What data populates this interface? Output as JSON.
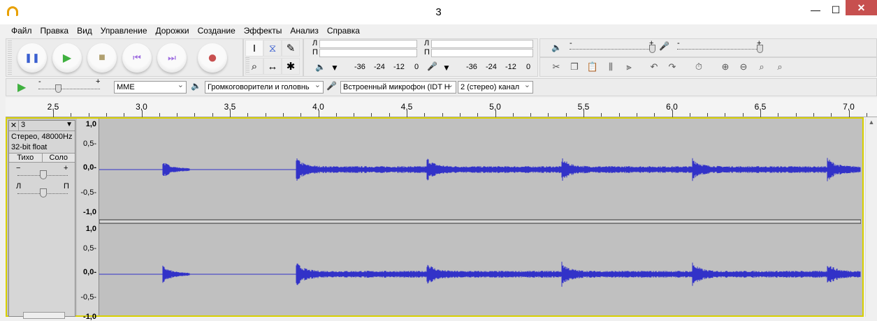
{
  "window": {
    "title": "3",
    "minimize": "—",
    "maximize": "☐",
    "close": "✕"
  },
  "menu": [
    "Файл",
    "Правка",
    "Вид",
    "Управление",
    "Дорожки",
    "Создание",
    "Эффекты",
    "Анализ",
    "Справка"
  ],
  "transport": {
    "pause": "❚❚",
    "play": "▶",
    "stop": "■",
    "skip_start": "⏮",
    "skip_end": "⏭",
    "record": "●"
  },
  "tools": {
    "select": "I",
    "envelope": "⧖",
    "draw": "✎",
    "zoom": "⌕",
    "timeshift": "↔",
    "multi": "✱"
  },
  "meters": {
    "left": "Л",
    "right": "П",
    "ticks": [
      "-36",
      "-24",
      "-12",
      "0"
    ]
  },
  "mixer": {
    "minus": "-",
    "plus": "+"
  },
  "devices": {
    "host": "MME",
    "output": "Громкоговорители и головнь",
    "input": "Встроенный микрофон (IDT H",
    "channels": "2 (стерео) канал"
  },
  "play_at_speed": {
    "minus": "-",
    "plus": "+"
  },
  "ruler": [
    "2,5",
    "3,0",
    "3,5",
    "4,0",
    "4,5",
    "5,0",
    "5,5",
    "6,0",
    "6,5",
    "7,0"
  ],
  "track": {
    "name": "3",
    "format": "Стерео, 48000Hz",
    "bitdepth": "32-bit float",
    "mute": "Тихо",
    "solo": "Соло",
    "gain_minus": "−",
    "gain_plus": "+",
    "pan_left": "Л",
    "pan_right": "П",
    "scale": [
      "1,0",
      "0,5-",
      "0,0-",
      "-0,5-",
      "-1,0"
    ]
  },
  "colors": {
    "wave": "#3232c8",
    "bg": "#c0c0c0",
    "selection": "#d8d000"
  }
}
